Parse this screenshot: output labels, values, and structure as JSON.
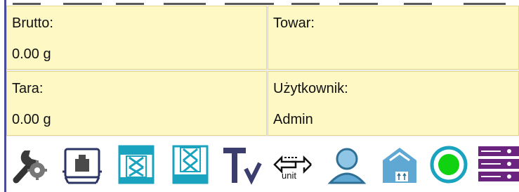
{
  "fields": {
    "brutto": {
      "label": "Brutto:",
      "value": "0.00 g"
    },
    "towar": {
      "label": "Towar:",
      "value": ""
    },
    "tara": {
      "label": "Tara:",
      "value": "0.00 g"
    },
    "uzytkownik": {
      "label": "Użytkownik:",
      "value": "Admin"
    }
  },
  "toolbar": {
    "buttons": [
      {
        "name": "settings-tools-icon"
      },
      {
        "name": "scale-tare-icon"
      },
      {
        "name": "form-x-icon"
      },
      {
        "name": "form-x-stack-icon"
      },
      {
        "name": "tare-value-icon"
      },
      {
        "name": "unit-switch-icon",
        "text": "unit"
      },
      {
        "name": "user-icon"
      },
      {
        "name": "package-icon"
      },
      {
        "name": "status-indicator-icon"
      },
      {
        "name": "database-icon"
      }
    ]
  },
  "colors": {
    "cell_bg": "#fdf8c4",
    "accent_teal": "#1aa3bf",
    "accent_purple": "#6b2380",
    "status_green": "#10d210",
    "user_blue": "#5fa8d3"
  }
}
